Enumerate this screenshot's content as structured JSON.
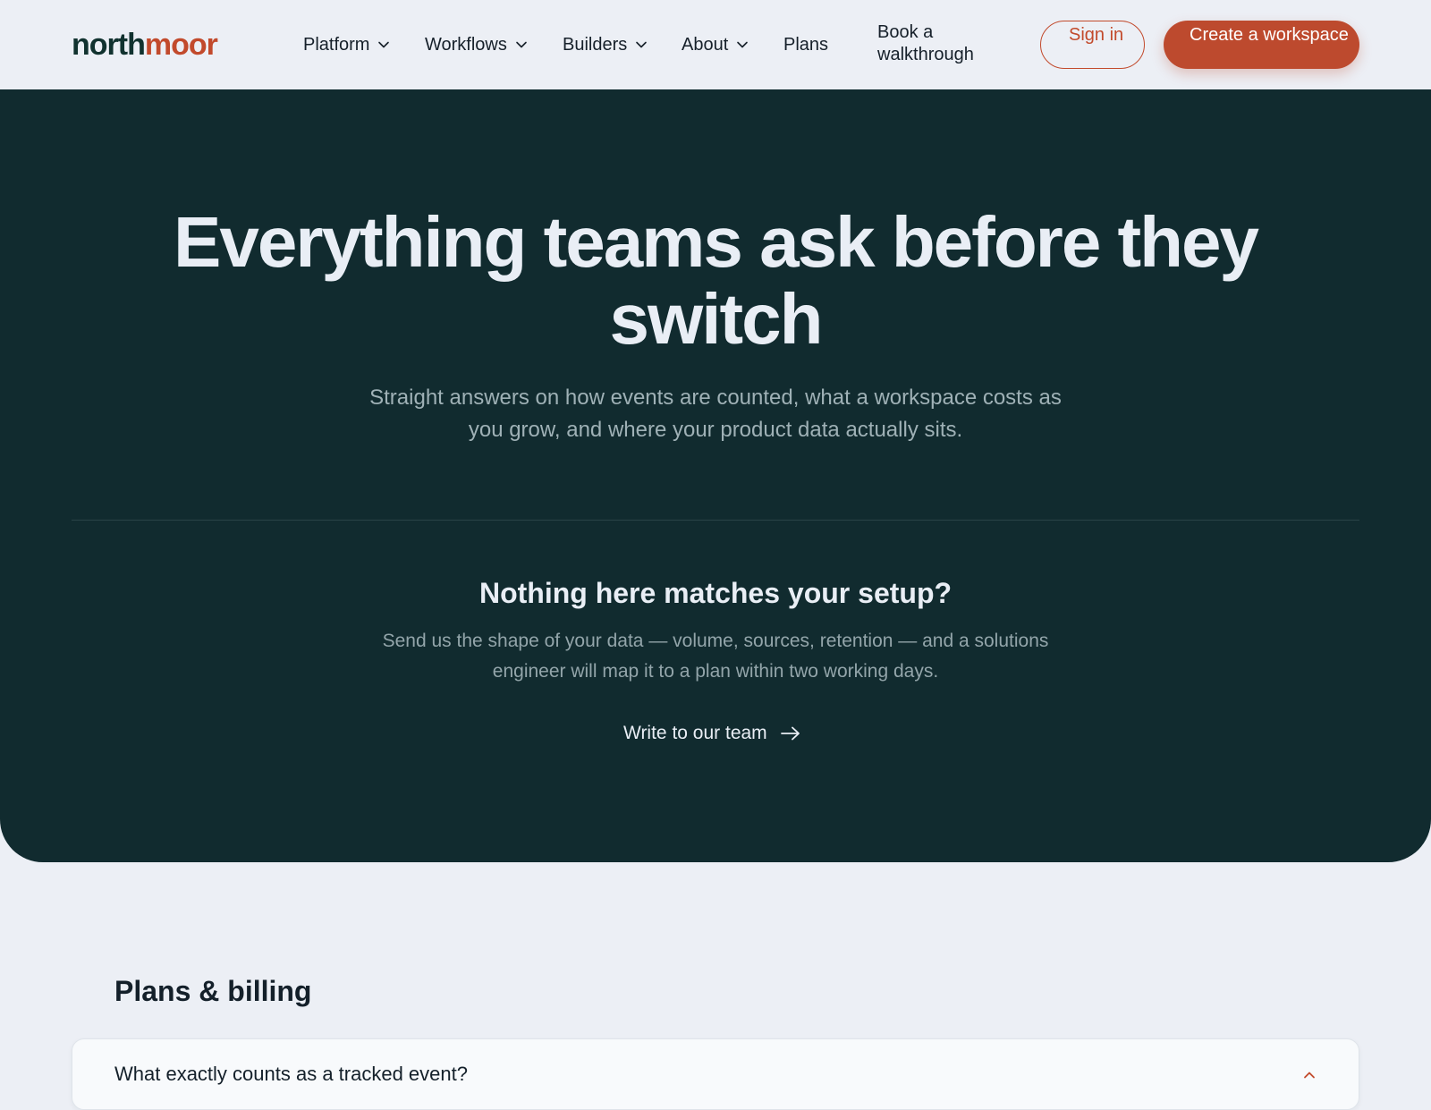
{
  "brand": {
    "logo_part1": "north",
    "logo_part2": "moor",
    "accent_color": "#c24a2c",
    "dark_color": "#112b2f"
  },
  "nav": {
    "platform": "Platform",
    "workflows": "Workflows",
    "builders": "Builders",
    "about": "About",
    "plans": "Plans",
    "walkthrough": "Book a walkthrough",
    "sign_in": "Sign in",
    "create": "Create a workspace",
    "dropdown_icon": "chevron-down-icon"
  },
  "hero": {
    "title": "Everything teams ask before they switch",
    "subtitle": "Straight answers on how events are counted, what a workspace costs as you grow, and where your product data actually sits."
  },
  "cta": {
    "title": "Nothing here matches your setup?",
    "text": "Send us the shape of your data — volume, sources, retention — and a solutions engineer will map it to a plan within two working days.",
    "link": "Write to our team",
    "link_icon": "arrow-right-icon"
  },
  "faq": {
    "section_title": "Plans & billing",
    "items": [
      {
        "question": "What exactly counts as a tracked event?",
        "expanded": true
      }
    ]
  }
}
